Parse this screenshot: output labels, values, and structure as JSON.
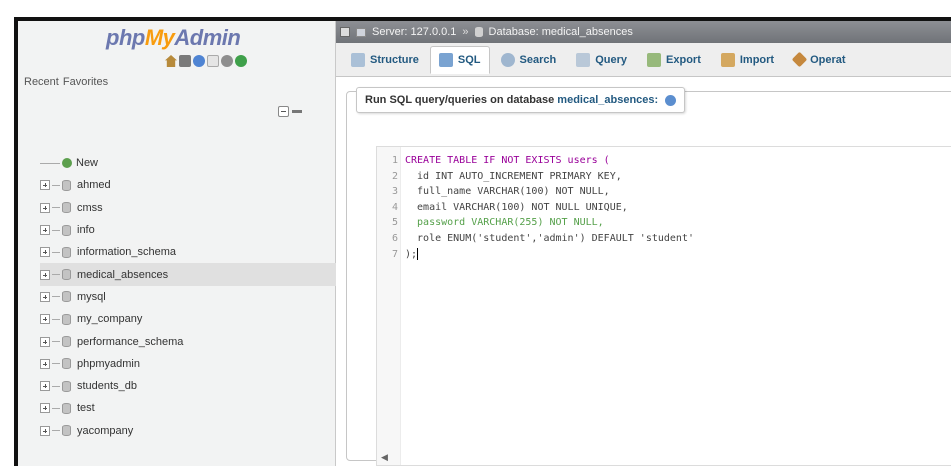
{
  "sidebar": {
    "logo": {
      "php": "php",
      "my": "My",
      "admin": "Admin"
    },
    "logo_icons": [
      "home-icon",
      "exit-icon",
      "info-icon",
      "docs-icon",
      "settings-icon",
      "reload-icon"
    ],
    "recent_label": "Recent",
    "favorites_label": "Favorites",
    "new_label": "New",
    "databases": [
      "ahmed",
      "cmss",
      "info",
      "information_schema",
      "medical_absences",
      "mysql",
      "my_company",
      "performance_schema",
      "phpmyadmin",
      "students_db",
      "test",
      "yacompany"
    ],
    "selected_db": "medical_absences"
  },
  "breadcrumb": {
    "server_label": "Server:",
    "server_value": "127.0.0.1",
    "database_label": "Database:",
    "database_value": "medical_absences"
  },
  "tabs": [
    {
      "label": "Structure",
      "icon": "structure-icon"
    },
    {
      "label": "SQL",
      "icon": "sql-icon",
      "active": true
    },
    {
      "label": "Search",
      "icon": "search-icon"
    },
    {
      "label": "Query",
      "icon": "query-icon"
    },
    {
      "label": "Export",
      "icon": "export-icon"
    },
    {
      "label": "Import",
      "icon": "import-icon"
    },
    {
      "label": "Operat",
      "icon": "operations-icon"
    }
  ],
  "sql_panel": {
    "legend_prefix": "Run SQL query/queries on database",
    "legend_db": "medical_absences:"
  },
  "editor": {
    "lines": [
      "CREATE TABLE IF NOT EXISTS users (",
      "  id INT AUTO_INCREMENT PRIMARY KEY,",
      "  full_name VARCHAR(100) NOT NULL,",
      "  email VARCHAR(100) NOT NULL UNIQUE,",
      "  password VARCHAR(255) NOT NULL,",
      "  role ENUM('student','admin') DEFAULT 'student'",
      ");"
    ],
    "line_numbers": [
      "1",
      "2",
      "3",
      "4",
      "5",
      "6",
      "7"
    ]
  }
}
